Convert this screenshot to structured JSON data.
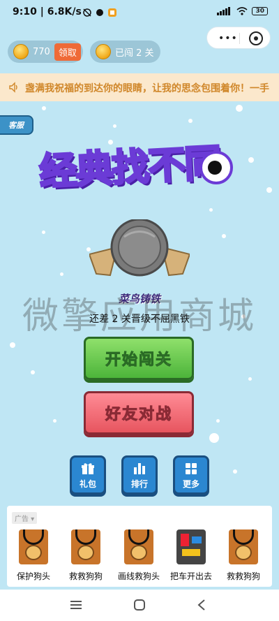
{
  "status_bar": {
    "time": "9:10",
    "speed": "6.8K/s",
    "battery": "30"
  },
  "header": {
    "coins": "770",
    "claim_label": "领取",
    "level_label": "已闯 2 关"
  },
  "marquee": {
    "text": "盏满我祝福的到达你的眼睛，让我的思念包围着你！一手"
  },
  "service_label": "客服",
  "title": "经典找不同",
  "rank": {
    "name": "菜鸟铸铁",
    "hint": "还差 2 关晋级不屈黑铁"
  },
  "watermark": "微擎应用商城",
  "buttons": {
    "start": "开始闯关",
    "battle": "好友对战",
    "gift": "礼包",
    "ranking": "排行",
    "more": "更多"
  },
  "ad": {
    "tag": "广告",
    "items": [
      {
        "label": "保护狗头"
      },
      {
        "label": "救救狗狗"
      },
      {
        "label": "画线救狗头"
      },
      {
        "label": "把车开出去"
      },
      {
        "label": "救救狗狗"
      }
    ]
  },
  "icons": [
    "speaker-icon",
    "coin-icon",
    "gift-icon",
    "bar-chart-icon",
    "grid-icon",
    "wifi-icon",
    "signal-icon",
    "battery-icon"
  ]
}
